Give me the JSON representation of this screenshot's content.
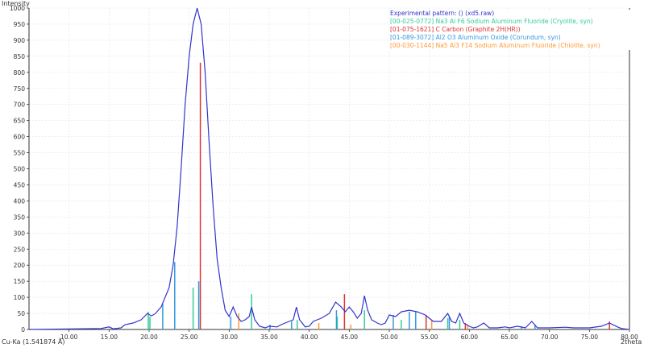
{
  "chart_data": {
    "type": "line",
    "title": "",
    "ylabel": "Intensity",
    "xlabel": "2theta",
    "wavelength_label": "Cu-Ka (1.541874 Å)",
    "xlim": [
      5,
      80
    ],
    "ylim": [
      0,
      1000
    ],
    "xticks": [
      "10.00",
      "15.00",
      "20.00",
      "25.00",
      "30.00",
      "35.00",
      "40.00",
      "45.00",
      "50.00",
      "55.00",
      "60.00",
      "65.00",
      "70.00",
      "75.00",
      "80.00"
    ],
    "xtick_values": [
      10,
      15,
      20,
      25,
      30,
      35,
      40,
      45,
      50,
      55,
      60,
      65,
      70,
      75,
      80
    ],
    "yticks": [
      0,
      50,
      100,
      150,
      200,
      250,
      300,
      350,
      400,
      450,
      500,
      550,
      600,
      650,
      700,
      750,
      800,
      850,
      900,
      950,
      1000
    ],
    "grid": true,
    "legend_position": "top-right",
    "series": [
      {
        "name": "Experimental pattern: () (xd5.raw)",
        "color": "#3333cc",
        "kind": "profile",
        "points": [
          [
            5,
            0
          ],
          [
            14,
            3
          ],
          [
            15,
            8
          ],
          [
            15.5,
            2
          ],
          [
            16.5,
            5
          ],
          [
            17,
            15
          ],
          [
            18,
            20
          ],
          [
            19,
            30
          ],
          [
            19.8,
            50
          ],
          [
            20.3,
            42
          ],
          [
            20.8,
            50
          ],
          [
            21.5,
            70
          ],
          [
            22.5,
            130
          ],
          [
            23,
            200
          ],
          [
            23.5,
            320
          ],
          [
            24,
            500
          ],
          [
            24.5,
            700
          ],
          [
            25,
            850
          ],
          [
            25.5,
            950
          ],
          [
            26,
            1000
          ],
          [
            26.5,
            950
          ],
          [
            27,
            800
          ],
          [
            27.5,
            580
          ],
          [
            28,
            380
          ],
          [
            28.5,
            220
          ],
          [
            29,
            130
          ],
          [
            29.5,
            60
          ],
          [
            30,
            40
          ],
          [
            30.5,
            70
          ],
          [
            31,
            40
          ],
          [
            31.5,
            25
          ],
          [
            32,
            30
          ],
          [
            32.5,
            40
          ],
          [
            32.8,
            70
          ],
          [
            33.2,
            30
          ],
          [
            33.8,
            10
          ],
          [
            34.5,
            5
          ],
          [
            35,
            10
          ],
          [
            36,
            8
          ],
          [
            36.5,
            15
          ],
          [
            37.5,
            25
          ],
          [
            38,
            30
          ],
          [
            38.4,
            70
          ],
          [
            38.8,
            30
          ],
          [
            39.5,
            8
          ],
          [
            40,
            10
          ],
          [
            40.5,
            25
          ],
          [
            41.5,
            35
          ],
          [
            42.5,
            50
          ],
          [
            43.3,
            85
          ],
          [
            44,
            70
          ],
          [
            44.5,
            55
          ],
          [
            45,
            70
          ],
          [
            45.5,
            55
          ],
          [
            46,
            35
          ],
          [
            46.5,
            50
          ],
          [
            46.9,
            105
          ],
          [
            47.3,
            60
          ],
          [
            47.8,
            30
          ],
          [
            48.5,
            20
          ],
          [
            49,
            15
          ],
          [
            49.5,
            20
          ],
          [
            50,
            45
          ],
          [
            50.8,
            40
          ],
          [
            51.5,
            55
          ],
          [
            52.5,
            60
          ],
          [
            53.5,
            55
          ],
          [
            54.5,
            45
          ],
          [
            55,
            35
          ],
          [
            55.5,
            25
          ],
          [
            56.5,
            25
          ],
          [
            57.3,
            50
          ],
          [
            57.8,
            25
          ],
          [
            58.3,
            20
          ],
          [
            58.8,
            50
          ],
          [
            59.3,
            20
          ],
          [
            60,
            10
          ],
          [
            60.5,
            5
          ],
          [
            61,
            8
          ],
          [
            61.8,
            20
          ],
          [
            62.5,
            5
          ],
          [
            63.5,
            5
          ],
          [
            64.5,
            8
          ],
          [
            65,
            5
          ],
          [
            66,
            10
          ],
          [
            67,
            5
          ],
          [
            67.8,
            25
          ],
          [
            68.5,
            5
          ],
          [
            70,
            5
          ],
          [
            72,
            7
          ],
          [
            73,
            5
          ],
          [
            75,
            5
          ],
          [
            76.5,
            10
          ],
          [
            77.5,
            20
          ],
          [
            78.5,
            8
          ],
          [
            79,
            3
          ],
          [
            80,
            0
          ]
        ]
      },
      {
        "name": "[00-025-0772] Na3 Al F6 Sodium Aluminum Fluoride (Cryolite, syn)",
        "color": "#33cc99",
        "kind": "sticks",
        "sticks": [
          [
            19.9,
            55
          ],
          [
            20.1,
            40
          ],
          [
            25.5,
            130
          ],
          [
            32.8,
            110
          ],
          [
            38.5,
            30
          ],
          [
            43.5,
            40
          ],
          [
            46.9,
            60
          ],
          [
            51.5,
            30
          ],
          [
            57.3,
            35
          ],
          [
            58.8,
            30
          ]
        ]
      },
      {
        "name": "[01-075-1621] C Carbon (Graphite 2H(HR))",
        "color": "#dd3333",
        "kind": "sticks",
        "sticks": [
          [
            26.4,
            830
          ],
          [
            44.4,
            110
          ],
          [
            54.6,
            45
          ],
          [
            59.5,
            20
          ],
          [
            77.5,
            25
          ]
        ]
      },
      {
        "name": "[01-089-3072] Al2 O3 Aluminum Oxide (Corundum, syn)",
        "color": "#3399dd",
        "kind": "sticks",
        "sticks": [
          [
            21.7,
            80
          ],
          [
            23.2,
            210
          ],
          [
            26.2,
            150
          ],
          [
            30.2,
            40
          ],
          [
            35.1,
            15
          ],
          [
            37.8,
            25
          ],
          [
            43.4,
            60
          ],
          [
            50.5,
            45
          ],
          [
            52.5,
            55
          ],
          [
            53.3,
            55
          ],
          [
            57.5,
            40
          ],
          [
            66.5,
            10
          ],
          [
            68.2,
            15
          ]
        ]
      },
      {
        "name": "[00-030-1144] Na5 Al3 F14 Sodium Aluminum Fluoride (Chiolite, syn)",
        "color": "#ff9933",
        "kind": "sticks",
        "sticks": [
          [
            31.2,
            50
          ],
          [
            41.2,
            20
          ],
          [
            45.2,
            15
          ],
          [
            55.3,
            30
          ],
          [
            59.8,
            15
          ]
        ]
      }
    ]
  }
}
